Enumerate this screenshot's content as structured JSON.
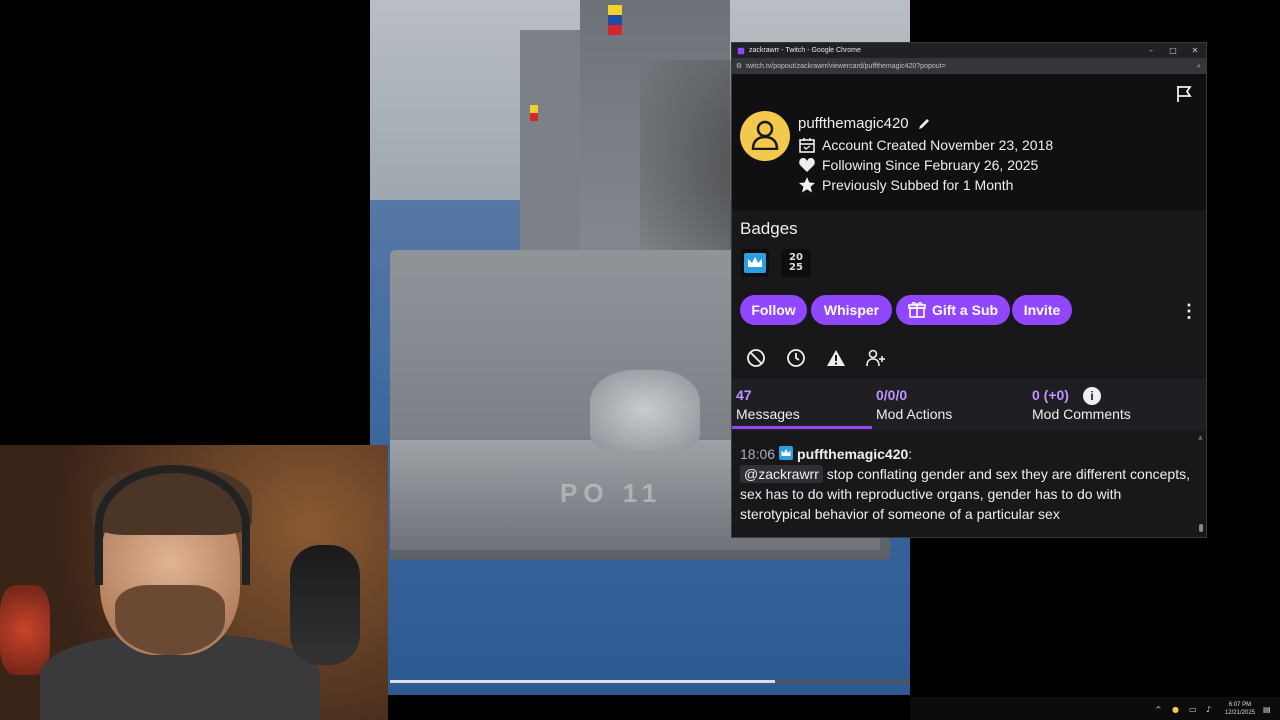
{
  "window": {
    "title": "zackrawrr - Twitch - Google Chrome",
    "url": "twitch.tv/popout/zackrawrr/viewercard/puffthemagic420?popout="
  },
  "user": {
    "username": "puffthemagic420",
    "account_created": "Account Created November 23, 2018",
    "following_since": "Following Since February 26, 2025",
    "subbed": "Previously Subbed for 1 Month"
  },
  "badges": {
    "title": "Badges",
    "year_badge_top": "20",
    "year_badge_bottom": "25"
  },
  "actions": {
    "follow": "Follow",
    "whisper": "Whisper",
    "gift": "Gift a Sub",
    "invite": "Invite",
    "more": "⋮"
  },
  "stats": {
    "messages_count": "47",
    "messages_label": "Messages",
    "mod_actions_count": "0/0/0",
    "mod_actions_label": "Mod Actions",
    "mod_comments_count": "0 (+0)",
    "mod_comments_label": "Mod Comments",
    "info": "i"
  },
  "chat": {
    "time": "18:06",
    "username": "puffthemagic420",
    "colon": ":",
    "mention": "@zackrawrr",
    "message": " stop conflating gender and sex they are different concepts, sex has to do with reproductive organs, gender has to do with sterotypical behavior of someone of a particular sex"
  },
  "video": {
    "hull_marking": "PO 11",
    "progress": 0.74
  },
  "taskbar": {
    "time": "6:07 PM",
    "date": "12/21/2025"
  },
  "colors": {
    "accent": "#9147ff",
    "accent_light": "#bf94ff",
    "sub_badge": "#2d9ee0",
    "avatar": "#f2c94c",
    "panel_bg": "#18181b"
  },
  "icons": [
    "report-flag-icon",
    "edit-pencil-icon",
    "calendar-icon",
    "heart-icon",
    "star-icon",
    "gift-icon",
    "ban-icon",
    "timeout-clock-icon",
    "warning-icon",
    "add-mod-icon",
    "info-icon"
  ]
}
